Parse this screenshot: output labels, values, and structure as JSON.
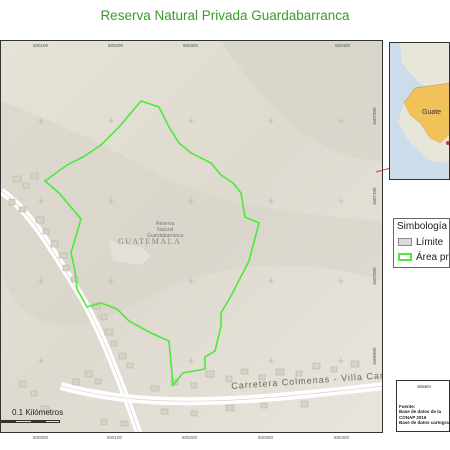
{
  "title": "Reserva Natural Privada Guardabarranca",
  "map": {
    "town_label": "GUATEMALA",
    "reserve_label": [
      "Reserva",
      "Natural",
      "Guardabarranca"
    ],
    "road_label": "Carretera Colmenas - Villa Can",
    "x_ticks_top": [
      "500100",
      "500200",
      "500300",
      "500400"
    ],
    "x_ticks_bottom": [
      "500000",
      "500100",
      "500200",
      "500300",
      "500400"
    ],
    "y_ticks": [
      "1607200",
      "1607100",
      "1607000",
      "1606900"
    ],
    "scale_label": "0.1 Kilómetros",
    "boundary_color": "#4ee83a"
  },
  "inset": {
    "region_label": "Guate"
  },
  "legend": {
    "title": "Simbología",
    "items": [
      {
        "label": "Límite",
        "color": "#dcdcdc"
      },
      {
        "label": "Área pr",
        "color": "#4ee83a"
      }
    ]
  },
  "info": {
    "lines": [
      "Sistem",
      "Fuente:",
      "Base de datos de la",
      "CONAP 2016",
      "Base de datos cartogra"
    ]
  }
}
